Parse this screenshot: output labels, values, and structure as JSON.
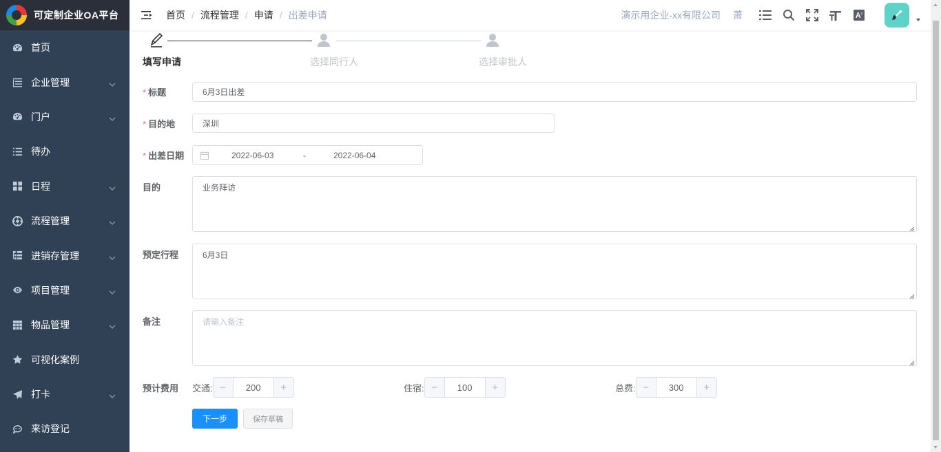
{
  "app": {
    "title": "可定制企业OA平台"
  },
  "sidebar": {
    "items": [
      {
        "label": "首页",
        "icon": "dashboard-icon",
        "expandable": false
      },
      {
        "label": "企业管理",
        "icon": "tree-list-icon",
        "expandable": true
      },
      {
        "label": "门户",
        "icon": "dashboard-icon",
        "expandable": true
      },
      {
        "label": "待办",
        "icon": "list-icon",
        "expandable": false
      },
      {
        "label": "日程",
        "icon": "grid-icon",
        "expandable": true
      },
      {
        "label": "流程管理",
        "icon": "process-icon",
        "expandable": true
      },
      {
        "label": "进销存管理",
        "icon": "tree-table-icon",
        "expandable": true
      },
      {
        "label": "项目管理",
        "icon": "eye-icon",
        "expandable": true
      },
      {
        "label": "物品管理",
        "icon": "table-icon",
        "expandable": true
      },
      {
        "label": "可视化案例",
        "icon": "star-icon",
        "expandable": false
      },
      {
        "label": "打卡",
        "icon": "paper-plane-icon",
        "expandable": true
      },
      {
        "label": "来访登记",
        "icon": "visitor-icon",
        "expandable": false
      }
    ]
  },
  "breadcrumb": [
    "首页",
    "流程管理",
    "申请",
    "出差申请"
  ],
  "header": {
    "company": "演示用企业-xx有限公司",
    "user_char": "萧"
  },
  "steps": [
    {
      "title": "填写申请",
      "status": "active"
    },
    {
      "title": "选择同行人",
      "status": "wait"
    },
    {
      "title": "选择审批人",
      "status": "wait"
    }
  ],
  "form": {
    "title": {
      "label": "标题",
      "value": "6月3日出差",
      "required": true
    },
    "destination": {
      "label": "目的地",
      "value": "深圳",
      "required": true
    },
    "trip_date": {
      "label": "出差日期",
      "start": "2022-06-03",
      "separator": "-",
      "end": "2022-06-04",
      "required": true
    },
    "purpose": {
      "label": "目的",
      "value": "业务拜访"
    },
    "itinerary": {
      "label": "预定行程",
      "value": "6月3日"
    },
    "remark": {
      "label": "备注",
      "placeholder": "请输入备注"
    },
    "cost": {
      "label": "预计费用",
      "items": [
        {
          "label": "交通:",
          "value": "200"
        },
        {
          "label": "住宿:",
          "value": "100"
        },
        {
          "label": "总费:",
          "value": "300"
        }
      ],
      "minus": "−",
      "plus": "+"
    }
  },
  "actions": {
    "next": "下一步",
    "save_draft": "保存草稿"
  },
  "colors": {
    "sidebar_bg": "#304156",
    "primary": "#1890ff",
    "required": "#f56c6c",
    "avatar_bg": "#5fd3c8"
  }
}
